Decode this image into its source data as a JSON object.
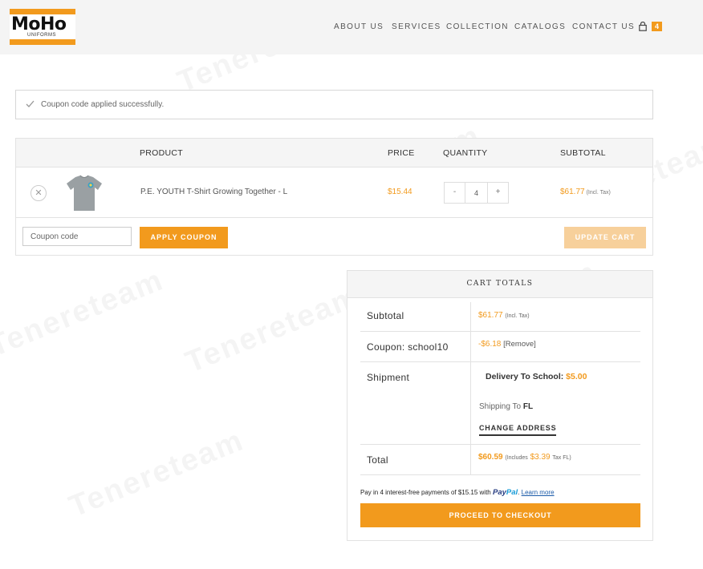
{
  "header": {
    "logo_text": "MoHo",
    "logo_sub": "UNIFORMS",
    "nav": [
      {
        "label": "ABOUT US"
      },
      {
        "label": "SERVICES"
      },
      {
        "label": "COLLECTION"
      },
      {
        "label": "CATALOGS"
      },
      {
        "label": "CONTACT US"
      }
    ],
    "cart_count": "4"
  },
  "notice": {
    "icon": "checkmark-icon",
    "message": "Coupon code applied successfully."
  },
  "cart": {
    "columns": {
      "product": "PRODUCT",
      "price": "PRICE",
      "quantity": "QUANTITY",
      "subtotal": "SUBTOTAL"
    },
    "items": [
      {
        "name": "P.E. YOUTH T-Shirt Growing Together - L",
        "price": "$15.44",
        "quantity": "4",
        "qty_minus": "-",
        "qty_plus": "+",
        "subtotal": "$61.77",
        "subtotal_note": "(Incl. Tax)"
      }
    ],
    "coupon_placeholder": "Coupon code",
    "apply_label": "APPLY COUPON",
    "update_label": "UPDATE CART"
  },
  "totals": {
    "title": "CART TOTALS",
    "subtotal_label": "Subtotal",
    "subtotal_value": "$61.77",
    "subtotal_note": "(Incl. Tax)",
    "coupon_label": "Coupon: school10",
    "coupon_value": "-$6.18",
    "coupon_remove": "[Remove]",
    "shipment_label": "Shipment",
    "shipping_method": "Delivery To School:",
    "shipping_cost": "$5.00",
    "shipping_to_prefix": "Shipping To",
    "shipping_to_state": "FL",
    "change_address": "CHANGE ADDRESS",
    "total_label": "Total",
    "total_value": "$60.59",
    "total_note_prefix": "(Includes",
    "total_tax": "$3.39",
    "total_note_suffix": "Tax FL)",
    "paypal_text": "Pay in 4 interest-free payments of $15.15 with",
    "paypal_brand_a": "Pay",
    "paypal_brand_b": "Pal",
    "paypal_learn": "Learn more",
    "checkout_label": "PROCEED TO CHECKOUT"
  },
  "watermark": "Tenereteam",
  "colors": {
    "accent": "#f29a1d",
    "accent_light": "#f7d09b",
    "paypal_dark": "#253b80",
    "paypal_light": "#179bd7"
  }
}
